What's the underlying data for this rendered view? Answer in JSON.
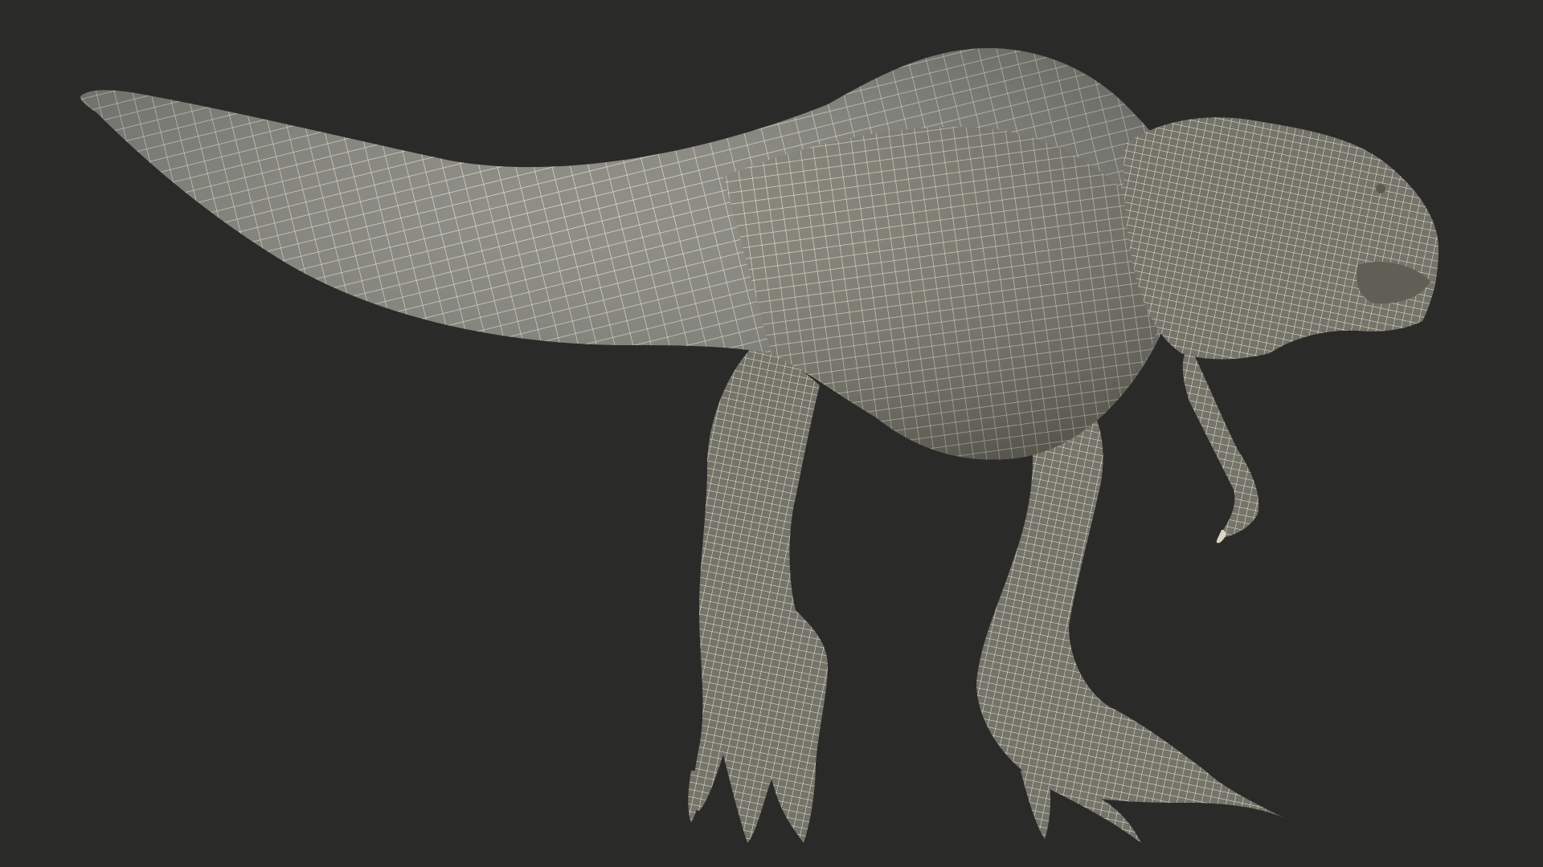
{
  "scene": {
    "subject_icon": "trex-wireframe-model",
    "background_color": "#2a2a28",
    "mesh_fill_color": "#7c7c70",
    "mesh_shadow_color": "#666659",
    "mesh_highlight_color": "#8b8b7f",
    "wire_color": "#ece9d8"
  }
}
